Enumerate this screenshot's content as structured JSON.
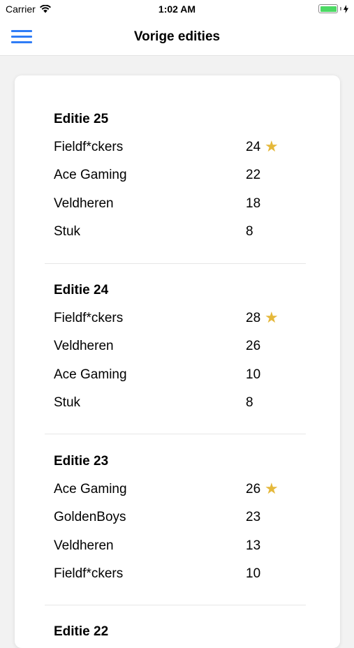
{
  "status_bar": {
    "carrier": "Carrier",
    "time": "1:02 AM"
  },
  "nav": {
    "title": "Vorige edities"
  },
  "accent_color": "#2f7cf6",
  "star_color": "#e5b83a",
  "editions": [
    {
      "title": "Editie 25",
      "rows": [
        {
          "team": "Fieldf*ckers",
          "score": "24",
          "winner": true
        },
        {
          "team": "Ace Gaming",
          "score": "22",
          "winner": false
        },
        {
          "team": "Veldheren",
          "score": "18",
          "winner": false
        },
        {
          "team": "Stuk",
          "score": "8",
          "winner": false
        }
      ]
    },
    {
      "title": "Editie 24",
      "rows": [
        {
          "team": "Fieldf*ckers",
          "score": "28",
          "winner": true
        },
        {
          "team": "Veldheren",
          "score": "26",
          "winner": false
        },
        {
          "team": "Ace Gaming",
          "score": "10",
          "winner": false
        },
        {
          "team": "Stuk",
          "score": "8",
          "winner": false
        }
      ]
    },
    {
      "title": "Editie 23",
      "rows": [
        {
          "team": "Ace Gaming",
          "score": "26",
          "winner": true
        },
        {
          "team": "GoldenBoys",
          "score": "23",
          "winner": false
        },
        {
          "team": "Veldheren",
          "score": "13",
          "winner": false
        },
        {
          "team": "Fieldf*ckers",
          "score": "10",
          "winner": false
        }
      ]
    },
    {
      "title": "Editie 22",
      "rows": []
    }
  ],
  "star_glyph": "★"
}
